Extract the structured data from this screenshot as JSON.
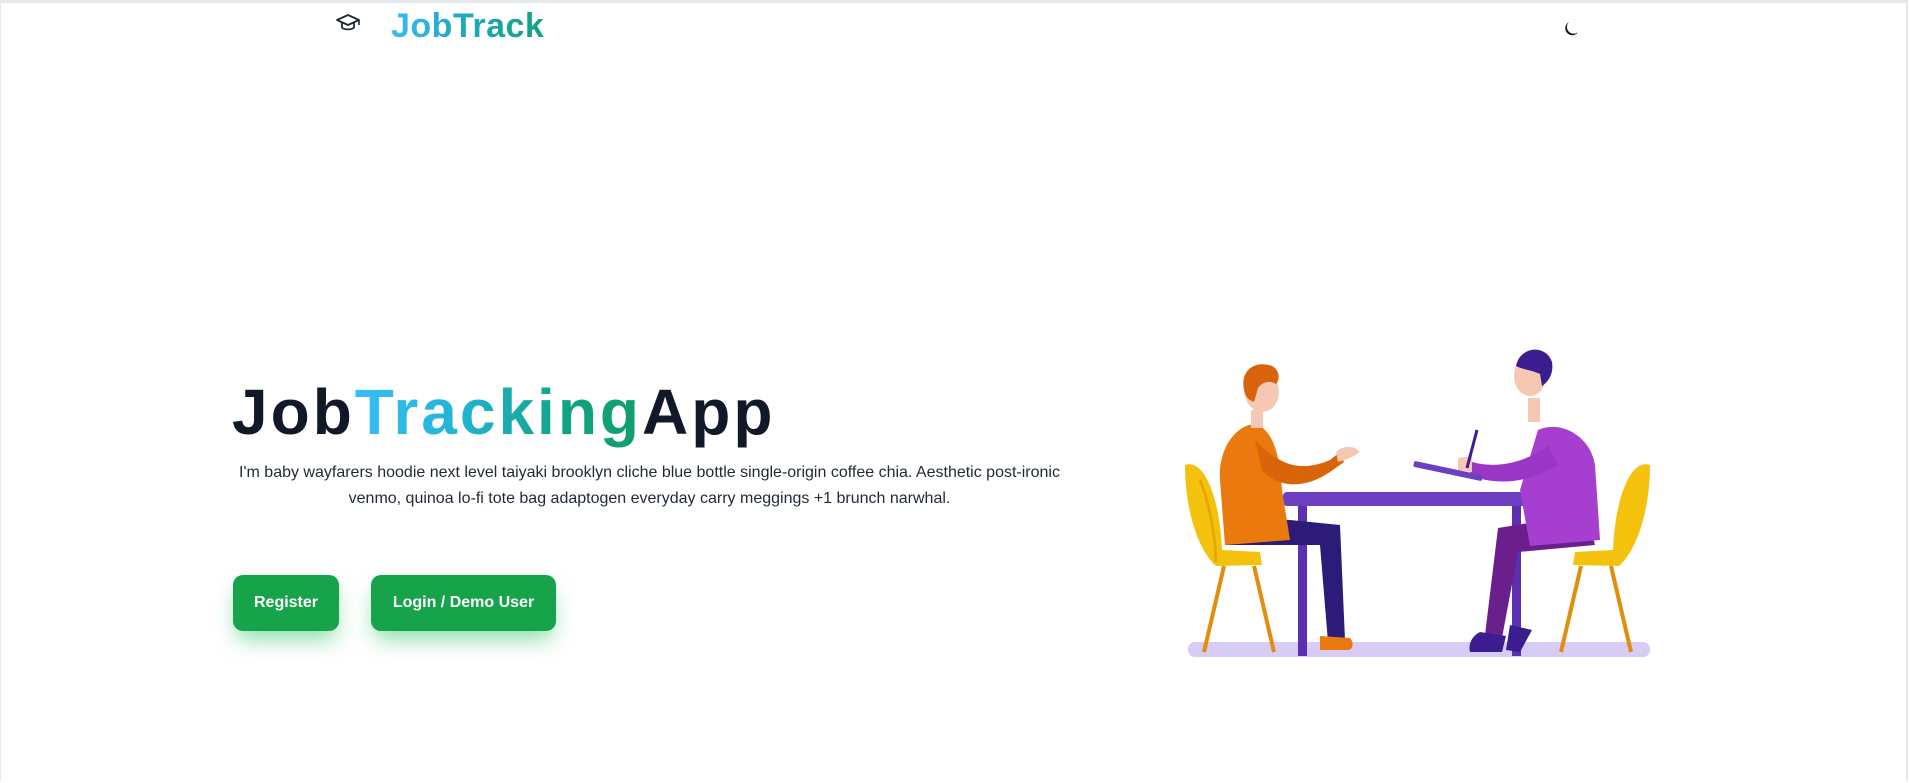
{
  "nav": {
    "brand": "JobTrack",
    "brand_icon": "graduation-cap-icon",
    "theme_icon": "moon-icon"
  },
  "hero": {
    "title_part1": "Job",
    "title_part2": "Tracking",
    "title_part3": "App",
    "description": "I'm baby wayfarers hoodie next level taiyaki brooklyn cliche blue bottle single-origin coffee chia. Aesthetic post-ironic venmo, quinoa lo-fi tote bag adaptogen everyday carry meggings +1 brunch narwhal.",
    "register_label": "Register",
    "login_label": "Login / Demo User"
  },
  "colors": {
    "brand_gradient_start": "#38bdf8",
    "brand_gradient_end": "#10a37f",
    "button": "#16a34a",
    "title_dark": "#111827"
  }
}
